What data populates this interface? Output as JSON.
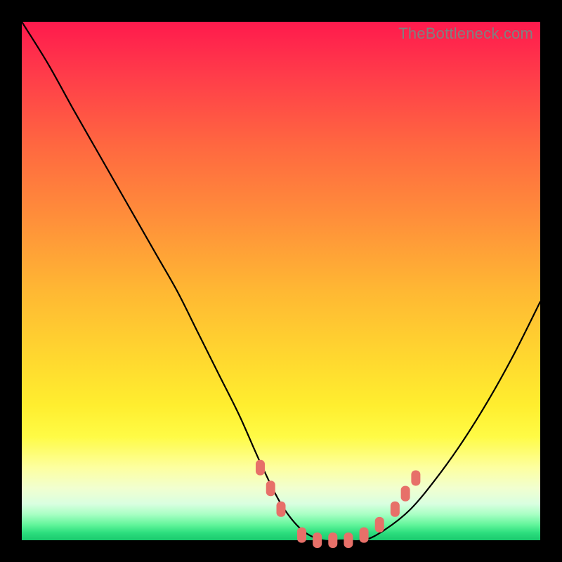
{
  "watermark": "TheBottleneck.com",
  "colors": {
    "frame": "#000000",
    "gradient_top": "#ff1a4d",
    "gradient_bottom": "#19c96d",
    "curve": "#000000",
    "marker": "#e77069"
  },
  "chart_data": {
    "type": "line",
    "title": "",
    "xlabel": "",
    "ylabel": "",
    "xlim": [
      0,
      100
    ],
    "ylim": [
      0,
      100
    ],
    "series": [
      {
        "name": "bottleneck-curve",
        "x": [
          0,
          5,
          10,
          14,
          18,
          22,
          26,
          30,
          34,
          38,
          42,
          46,
          50,
          54,
          58,
          62,
          66,
          70,
          75,
          80,
          85,
          90,
          95,
          100
        ],
        "y": [
          100,
          92,
          83,
          76,
          69,
          62,
          55,
          48,
          40,
          32,
          24,
          15,
          7,
          2,
          0,
          0,
          0,
          2,
          6,
          12,
          19,
          27,
          36,
          46
        ]
      }
    ],
    "markers": [
      {
        "name": "left-cluster-1",
        "x": 46,
        "y": 14
      },
      {
        "name": "left-cluster-2",
        "x": 48,
        "y": 10
      },
      {
        "name": "left-cluster-3",
        "x": 50,
        "y": 6
      },
      {
        "name": "bottom-1",
        "x": 54,
        "y": 1
      },
      {
        "name": "bottom-2",
        "x": 57,
        "y": 0
      },
      {
        "name": "bottom-3",
        "x": 60,
        "y": 0
      },
      {
        "name": "bottom-4",
        "x": 63,
        "y": 0
      },
      {
        "name": "bottom-5",
        "x": 66,
        "y": 1
      },
      {
        "name": "right-cluster-1",
        "x": 69,
        "y": 3
      },
      {
        "name": "right-cluster-2",
        "x": 72,
        "y": 6
      },
      {
        "name": "right-cluster-3",
        "x": 74,
        "y": 9
      },
      {
        "name": "right-cluster-4",
        "x": 76,
        "y": 12
      }
    ]
  }
}
